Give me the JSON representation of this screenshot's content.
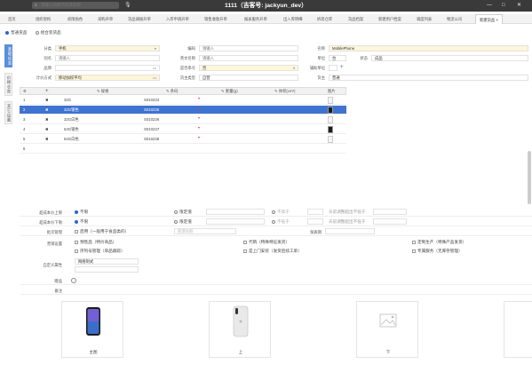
{
  "topbar": {
    "search_placeholder": "请输入功能代码或名称",
    "title": "1111（吉客号: jackyun_dev）",
    "win_min": "—",
    "win_max": "□",
    "win_close": "✕"
  },
  "tabs": [
    "首页",
    "组织架构",
    "权限角色",
    "采购开单",
    "货品调拨开单",
    "入库申请开单",
    "销售收款开单",
    "报表服务开单",
    "出入库明细",
    "拆装仓库",
    "货品档案",
    "新建用户档案",
    "调度列表",
    "物流公司",
    "新建货品"
  ],
  "subtabs": {
    "standard": "普通货品",
    "combo": "组合装货品"
  },
  "sidebar": [
    "基础信息",
    "价格仓库",
    "其它设置"
  ],
  "form": {
    "category_label": "分类",
    "category_value": "手机",
    "code_label": "编码",
    "code_placeholder": "请输入",
    "name_label": "名称",
    "name_value": "MobilePhone",
    "alias_label": "别名",
    "alias_placeholder": "请输入",
    "eng_label": "英文名称",
    "eng_placeholder": "请输入",
    "unit_label": "单位",
    "unit_value": "台",
    "status_label": "状态",
    "status_value": "成品",
    "brand_label": "品牌",
    "serial_label": "是否串号",
    "serial_value": "否",
    "aux_unit_label": "辅助单位",
    "cost_label": "计价方式",
    "cost_value": "移动加权平均",
    "type_label": "货主类型",
    "type_value": "自营",
    "fee_label": "货主",
    "fee_value": "普通"
  },
  "grid": {
    "headers": {
      "spec": "规格",
      "code": "条码",
      "weight": "重量(g)",
      "volume": "体积(cm³)",
      "image": "图片"
    },
    "rows": [
      {
        "no": "1",
        "spec": "32G",
        "code": "S010234",
        "img": false
      },
      {
        "no": "2",
        "spec": "32G银色",
        "code": "S010235",
        "img": true
      },
      {
        "no": "3",
        "spec": "32G白色",
        "code": "S010236",
        "img": false
      },
      {
        "no": "4",
        "spec": "64G银色",
        "code": "S010237",
        "img": true
      },
      {
        "no": "5",
        "spec": "64G白色",
        "code": "S010238",
        "img": false
      },
      {
        "no": "6",
        "spec": "",
        "code": "",
        "img": false
      }
    ]
  },
  "lower": {
    "stock_upper_label": "超成本价上限",
    "stock_lower_label": "超成本价下限",
    "upper_opt1": "不限",
    "upper_opt2": "限定值",
    "upper_opt3": "不高于",
    "upper_tail": "天前调整超出不低于",
    "lower_opt1": "不限",
    "lower_opt2": "限定值",
    "lower_opt3": "不低于",
    "lower_tail": "天前调整超出不低于",
    "period_label": "批次管理",
    "period_opt": "启用（一般用于食品类的）",
    "period_hint": "管理效期",
    "shelf_label": "保质期",
    "sale_label": "营销设置",
    "sale1": "预售品（特价商品）",
    "sale2": "代销（特殊特征发货）",
    "sale3": "定制生产（特殊产品发货）",
    "sale4": "序列号管理（单品跟踪）",
    "sale5": "是上门安装（发货后续工单）",
    "sale6": "专属服务（无库存管理）",
    "custom_label": "自定义属性",
    "custom_value": "网络制式",
    "gift_label": "赠品",
    "remark_label": "备注"
  },
  "images": [
    {
      "caption": "主图",
      "kind": "phone-front"
    },
    {
      "caption": "上",
      "kind": "phone-back"
    },
    {
      "caption": "下",
      "kind": "placeholder"
    }
  ]
}
